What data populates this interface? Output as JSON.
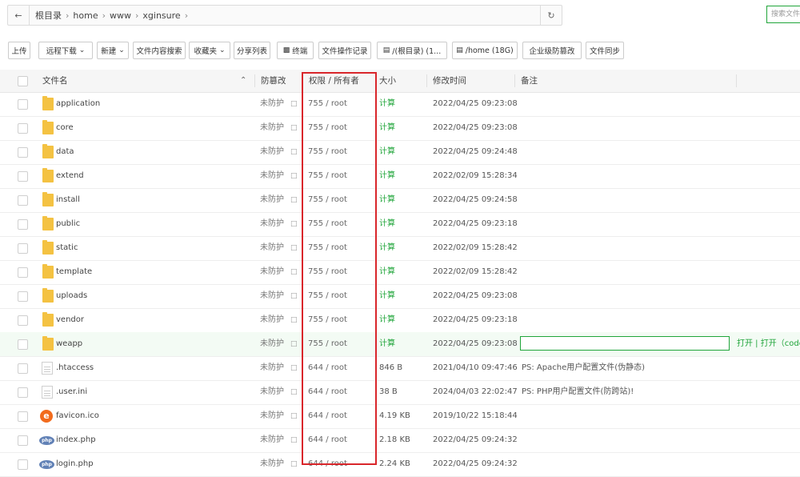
{
  "pathbar": {
    "crumbs": [
      "根目录",
      "home",
      "www",
      "xginsure"
    ],
    "separator": "›",
    "back_icon": "arrow-left-icon",
    "refresh_icon": "refresh-icon"
  },
  "search": {
    "placeholder": "搜索文件"
  },
  "toolbar": {
    "upload": "上传",
    "remote_download": "远程下载",
    "new": "新建",
    "content_search": "文件内容搜索",
    "favorites": "收藏夹",
    "share_list": "分享列表",
    "terminal": "终端",
    "operation_log": "文件操作记录",
    "disk_root": "/(根目录) (1...",
    "disk_home": "/home (18G)",
    "enterprise_protect": "企业级防篡改",
    "file_sync": "文件同步"
  },
  "table": {
    "headers": {
      "name": "文件名",
      "protect": "防篡改",
      "perm": "权限 / 所有者",
      "size": "大小",
      "mtime": "修改时间",
      "remark": "备注"
    },
    "sort_icon": "chevron-up-icon",
    "rows": [
      {
        "type": "folder",
        "name": "application",
        "protect": "未防护",
        "perm": "755 / root",
        "size": "计算",
        "mtime": "2022/04/25 09:23:08",
        "remark": ""
      },
      {
        "type": "folder",
        "name": "core",
        "protect": "未防护",
        "perm": "755 / root",
        "size": "计算",
        "mtime": "2022/04/25 09:23:08",
        "remark": ""
      },
      {
        "type": "folder",
        "name": "data",
        "protect": "未防护",
        "perm": "755 / root",
        "size": "计算",
        "mtime": "2022/04/25 09:24:48",
        "remark": ""
      },
      {
        "type": "folder",
        "name": "extend",
        "protect": "未防护",
        "perm": "755 / root",
        "size": "计算",
        "mtime": "2022/02/09 15:28:34",
        "remark": ""
      },
      {
        "type": "folder",
        "name": "install",
        "protect": "未防护",
        "perm": "755 / root",
        "size": "计算",
        "mtime": "2022/04/25 09:24:58",
        "remark": ""
      },
      {
        "type": "folder",
        "name": "public",
        "protect": "未防护",
        "perm": "755 / root",
        "size": "计算",
        "mtime": "2022/04/25 09:23:18",
        "remark": ""
      },
      {
        "type": "folder",
        "name": "static",
        "protect": "未防护",
        "perm": "755 / root",
        "size": "计算",
        "mtime": "2022/02/09 15:28:42",
        "remark": ""
      },
      {
        "type": "folder",
        "name": "template",
        "protect": "未防护",
        "perm": "755 / root",
        "size": "计算",
        "mtime": "2022/02/09 15:28:42",
        "remark": ""
      },
      {
        "type": "folder",
        "name": "uploads",
        "protect": "未防护",
        "perm": "755 / root",
        "size": "计算",
        "mtime": "2022/04/25 09:23:08",
        "remark": ""
      },
      {
        "type": "folder",
        "name": "vendor",
        "protect": "未防护",
        "perm": "755 / root",
        "size": "计算",
        "mtime": "2022/04/25 09:23:18",
        "remark": ""
      },
      {
        "type": "folder",
        "name": "weapp",
        "protect": "未防护",
        "perm": "755 / root",
        "size": "计算",
        "mtime": "2022/04/25 09:23:08",
        "remark": "",
        "highlight": true,
        "actions": "打开 | 打开（code-"
      },
      {
        "type": "file",
        "name": ".htaccess",
        "protect": "未防护",
        "perm": "644 / root",
        "size": "846 B",
        "mtime": "2021/04/10 09:47:46",
        "remark": "PS: Apache用户配置文件(伪静态)"
      },
      {
        "type": "file",
        "name": ".user.ini",
        "protect": "未防护",
        "perm": "644 / root",
        "size": "38 B",
        "mtime": "2024/04/03 22:02:47",
        "remark": "PS: PHP用户配置文件(防跨站)!"
      },
      {
        "type": "ico",
        "name": "favicon.ico",
        "protect": "未防护",
        "perm": "644 / root",
        "size": "4.19 KB",
        "mtime": "2019/10/22 15:18:44",
        "remark": ""
      },
      {
        "type": "php",
        "name": "index.php",
        "protect": "未防护",
        "perm": "644 / root",
        "size": "2.18 KB",
        "mtime": "2022/04/25 09:24:32",
        "remark": ""
      },
      {
        "type": "php",
        "name": "login.php",
        "protect": "未防护",
        "perm": "644 / root",
        "size": "2.24 KB",
        "mtime": "2022/04/25 09:24:32",
        "remark": ""
      }
    ]
  },
  "colors": {
    "accent": "#20a53a",
    "highlight_box": "#d9262b",
    "folder": "#f4c242"
  }
}
